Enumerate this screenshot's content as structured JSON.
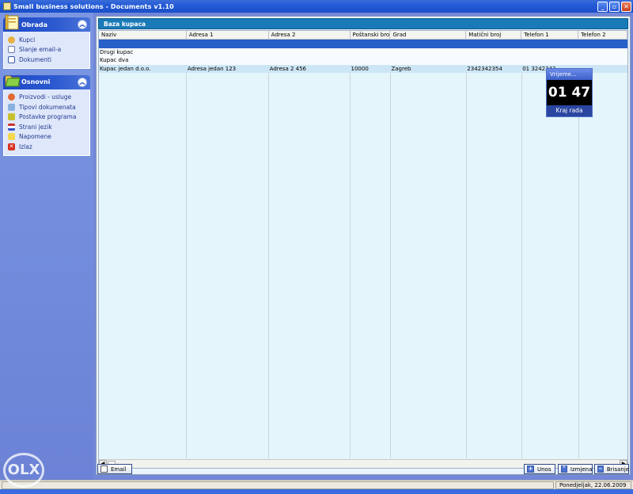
{
  "window": {
    "title": "Small business solutions - Documents v1.10",
    "buttons": {
      "minimize": "_",
      "maximize": "▫",
      "close": "✕"
    }
  },
  "sidebar": {
    "groups": [
      {
        "label": "Obrada",
        "items": [
          {
            "label": "Kupci",
            "icon": "person-icon"
          },
          {
            "label": "Slanje email-a",
            "icon": "mail-icon"
          },
          {
            "label": "Dokumenti",
            "icon": "document-icon"
          }
        ]
      },
      {
        "label": "Osnovni",
        "items": [
          {
            "label": "Proizvodi - usluge",
            "icon": "product-icon"
          },
          {
            "label": "Tipovi dokumenata",
            "icon": "doc-type-icon"
          },
          {
            "label": "Postavke programa",
            "icon": "settings-icon"
          },
          {
            "label": "Strani jezik",
            "icon": "flag-icon"
          },
          {
            "label": "Napomene",
            "icon": "note-icon"
          },
          {
            "label": "Izlaz",
            "icon": "exit-icon"
          }
        ]
      }
    ]
  },
  "panel": {
    "title": "Baza kupaca"
  },
  "table": {
    "columns": [
      "Naziv",
      "Adresa 1",
      "Adresa 2",
      "Poštanski broj",
      "Grad",
      "Matični broj",
      "Telefon 1",
      "Telefon 2"
    ],
    "rows": [
      [
        "",
        "",
        "",
        "",
        "",
        "",
        "",
        ""
      ],
      [
        "Drugi kupac",
        "",
        "",
        "",
        "",
        "",
        "",
        ""
      ],
      [
        "Kupac dva",
        "",
        "",
        "",
        "",
        "",
        "",
        ""
      ],
      [
        "Kupac jedan d.o.o.",
        "Adresa jedan 123",
        "Adresa 2 456",
        "10000",
        "Zagreb",
        "2342342354",
        "01 3242342",
        ""
      ]
    ],
    "selected_row": 0
  },
  "clock": {
    "title": "Vrijeme...",
    "time": "01 47",
    "button": "Kraj rada"
  },
  "bottom": {
    "email": "Email",
    "unos": "Unos",
    "izmjena": "Izmjena",
    "brisanje": "Brisanje"
  },
  "status": {
    "date": "Ponedjeljak, 22.06.2009"
  },
  "watermark": "OLX",
  "colors": {
    "accent": "#2660c8",
    "panel_title": "#1a7ab8",
    "sidebar": "#6b82d6"
  }
}
